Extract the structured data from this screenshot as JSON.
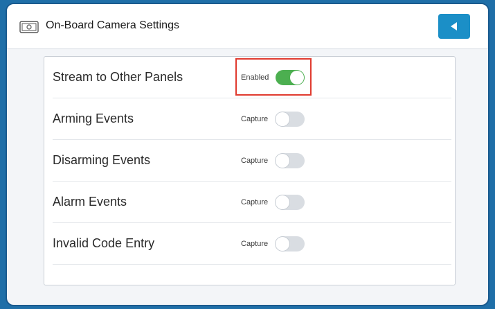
{
  "header": {
    "title": "On-Board Camera Settings",
    "icon": "camera-icon",
    "back_icon": "back-triangle-icon"
  },
  "settings": [
    {
      "label": "Stream to Other Panels",
      "state_text": "Enabled",
      "on": true
    },
    {
      "label": "Arming Events",
      "state_text": "Capture",
      "on": false
    },
    {
      "label": "Disarming Events",
      "state_text": "Capture",
      "on": false
    },
    {
      "label": "Alarm Events",
      "state_text": "Capture",
      "on": false
    },
    {
      "label": "Invalid Code Entry",
      "state_text": "Capture",
      "on": false
    }
  ],
  "colors": {
    "accent": "#1b8fc7",
    "toggle_on": "#4caf50",
    "highlight": "#e03a2e"
  }
}
